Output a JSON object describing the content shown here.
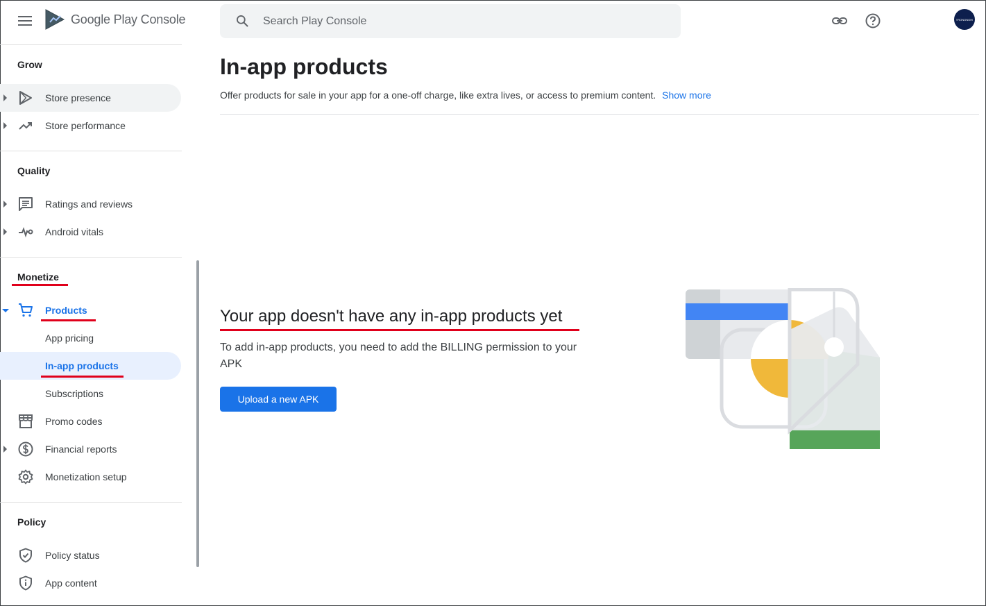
{
  "header": {
    "app_title": "Google Play Console",
    "search_placeholder": "Search Play Console",
    "avatar_text": "TRONGNGHI"
  },
  "sidebar": {
    "sections": {
      "grow": "Grow",
      "quality": "Quality",
      "monetize": "Monetize",
      "policy": "Policy"
    },
    "items": {
      "store_presence": "Store presence",
      "store_performance": "Store performance",
      "ratings_reviews": "Ratings and reviews",
      "android_vitals": "Android vitals",
      "products": "Products",
      "app_pricing": "App pricing",
      "in_app_products": "In-app products",
      "subscriptions": "Subscriptions",
      "promo_codes": "Promo codes",
      "financial_reports": "Financial reports",
      "monetization_setup": "Monetization setup",
      "policy_status": "Policy status",
      "app_content": "App content"
    }
  },
  "main": {
    "title": "In-app products",
    "description": "Offer products for sale in your app for a one-off charge, like extra lives, or access to premium content.",
    "show_more": "Show more",
    "empty_title": "Your app doesn't have any in-app products yet",
    "empty_text": "To add in-app products, you need to add the BILLING permission to your APK",
    "upload_button": "Upload a new APK"
  },
  "colors": {
    "accent": "#1a73e8",
    "annotation_red": "#e0001b",
    "illustration_blue": "#4285f4",
    "illustration_yellow": "#f0b83a",
    "illustration_green": "#57a55a"
  }
}
